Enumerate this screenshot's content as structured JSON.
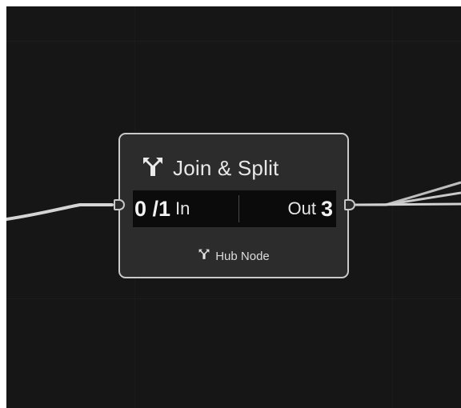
{
  "node": {
    "title": "Join & Split",
    "title_icon": "hub-fork-icon",
    "input": {
      "count": "0 /1",
      "label": "In"
    },
    "output": {
      "label": "Out",
      "count": "3"
    },
    "footer": {
      "icon": "hub-fork-icon",
      "label": "Hub Node"
    }
  },
  "colors": {
    "canvas": "#161616",
    "node_body": "#2c2c2c",
    "node_border": "#c9c9c9",
    "wire": "#d2d2d2",
    "text": "#e8e8e8"
  }
}
